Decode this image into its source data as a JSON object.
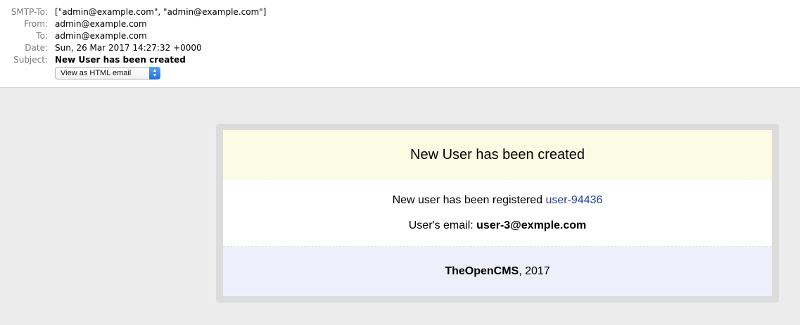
{
  "headers": {
    "smtp_to": {
      "label": "SMTP-To:",
      "value": "[\"admin@example.com\", \"admin@example.com\"]"
    },
    "from": {
      "label": "From:",
      "value": "admin@example.com"
    },
    "to": {
      "label": "To:",
      "value": "admin@example.com"
    },
    "date": {
      "label": "Date:",
      "value": "Sun, 26 Mar 2017 14:27:32 +0000"
    },
    "subject": {
      "label": "Subject:",
      "value": "New User has been created"
    }
  },
  "view_select": {
    "selected": "View as HTML email",
    "icon": "up-down-arrows-icon"
  },
  "email": {
    "title": "New User has been created",
    "registered_text": "New user has been registered ",
    "user_link": "user-94436",
    "email_label": "User's email: ",
    "email_value": "user-3@exmple.com",
    "footer_brand": "TheOpenCMS",
    "footer_year": ", 2017"
  },
  "colors": {
    "header_bg": "#fcfbe3",
    "footer_bg": "#efeffc",
    "link": "#20409a",
    "select_accent": "#1f6fe0"
  }
}
